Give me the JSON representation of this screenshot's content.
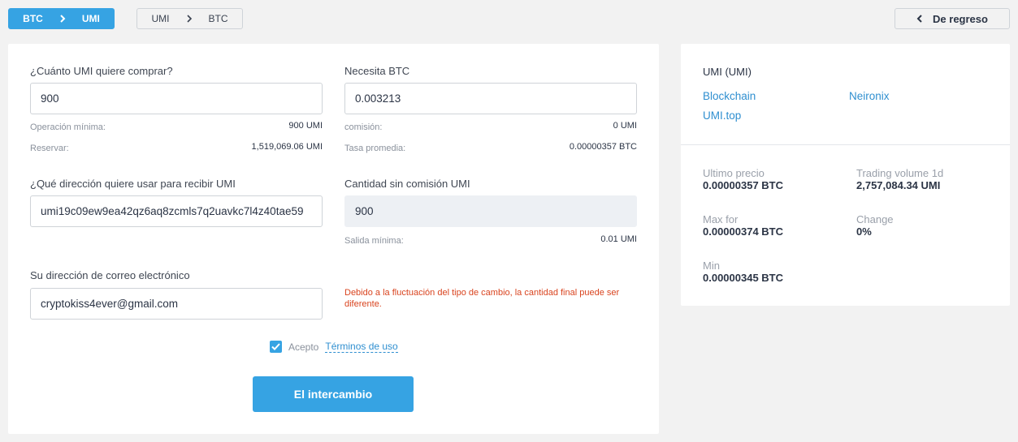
{
  "tabs": {
    "active": {
      "from": "BTC",
      "to": "UMI"
    },
    "inactive": {
      "from": "UMI",
      "to": "BTC"
    }
  },
  "back_button": {
    "label": "De regreso"
  },
  "form": {
    "buy": {
      "label": "¿Cuánto UMI quiere comprar?",
      "value": "900",
      "min_label": "Operación mínima:",
      "min_value": "900 UMI",
      "reserve_label": "Reservar:",
      "reserve_value": "1,519,069.06 UMI"
    },
    "need": {
      "label": "Necesita BTC",
      "value": "0.003213",
      "fee_label": "comisión:",
      "fee_value": "0 UMI",
      "rate_label": "Tasa promedia:",
      "rate_value": "0.00000357 BTC"
    },
    "address": {
      "label": "¿Qué dirección quiere usar para recibir UMI",
      "value": "umi19c09ew9ea42qz6aq8zcmls7q2uavkc7l4z40tae59"
    },
    "net": {
      "label": "Cantidad sin comisión UMI",
      "value": "900",
      "min_out_label": "Salida mínima:",
      "min_out_value": "0.01 UMI"
    },
    "email": {
      "label": "Su dirección de correo electrónico",
      "value": "cryptokiss4ever@gmail.com"
    },
    "warning": "Debido a la fluctuación del tipo de cambio, la cantidad final puede ser diferente.",
    "terms": {
      "prefix": "Acepto",
      "link": "Términos de uso",
      "checked": true
    },
    "submit": "El intercambio"
  },
  "info": {
    "title": "UMI (UMI)",
    "links": [
      "Blockchain",
      "Neironix",
      "UMI.top"
    ],
    "stats": {
      "last_price": {
        "label": "Ultimo precio",
        "value": "0.00000357 BTC"
      },
      "volume": {
        "label": "Trading volume 1d",
        "value": "2,757,084.34 UMI"
      },
      "max": {
        "label": "Max for",
        "value": "0.00000374 BTC"
      },
      "change": {
        "label": "Change",
        "value": "0%"
      },
      "min": {
        "label": "Min",
        "value": "0.00000345 BTC"
      }
    }
  },
  "colors": {
    "accent": "#36a3e3",
    "link": "#2f8fd0",
    "warning": "#d9441f",
    "background": "#f2f2f2"
  }
}
